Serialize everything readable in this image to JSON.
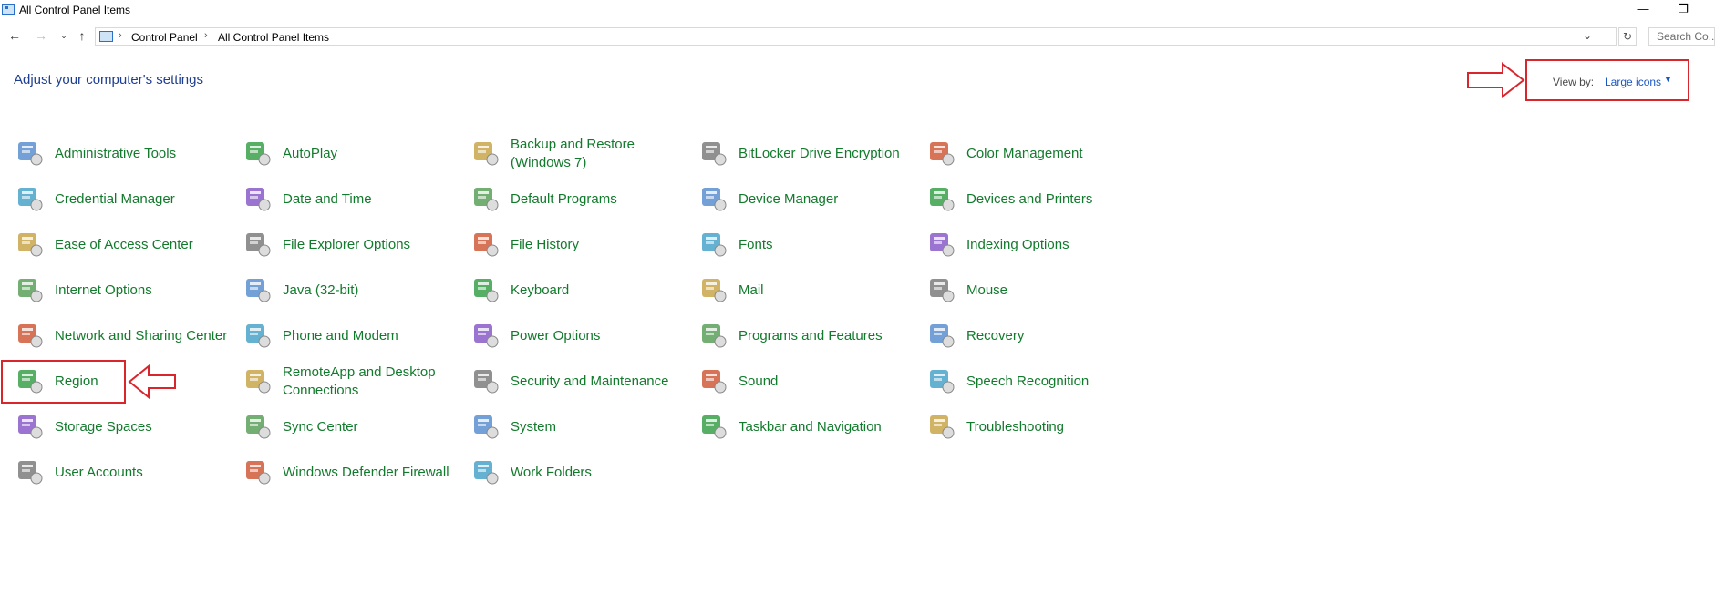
{
  "window": {
    "title": "All Control Panel Items",
    "minimize": "—",
    "restore": "❐"
  },
  "address": {
    "crumbs": [
      "Control Panel",
      "All Control Panel Items"
    ],
    "separator": "›",
    "search_placeholder": "Search Co..."
  },
  "header": {
    "title": "Adjust your computer's settings",
    "viewby_label": "View by:",
    "viewby_value": "Large icons"
  },
  "items": [
    {
      "label": "Administrative Tools",
      "icon": "administrative-tools-icon"
    },
    {
      "label": "AutoPlay",
      "icon": "autoplay-icon"
    },
    {
      "label": "Backup and Restore (Windows 7)",
      "icon": "backup-restore-icon"
    },
    {
      "label": "BitLocker Drive Encryption",
      "icon": "bitlocker-icon"
    },
    {
      "label": "Color Management",
      "icon": "color-management-icon"
    },
    {
      "label": "Credential Manager",
      "icon": "credential-manager-icon"
    },
    {
      "label": "Date and Time",
      "icon": "date-time-icon"
    },
    {
      "label": "Default Programs",
      "icon": "default-programs-icon"
    },
    {
      "label": "Device Manager",
      "icon": "device-manager-icon"
    },
    {
      "label": "Devices and Printers",
      "icon": "devices-printers-icon"
    },
    {
      "label": "Ease of Access Center",
      "icon": "ease-of-access-icon"
    },
    {
      "label": "File Explorer Options",
      "icon": "file-explorer-options-icon"
    },
    {
      "label": "File History",
      "icon": "file-history-icon"
    },
    {
      "label": "Fonts",
      "icon": "fonts-icon"
    },
    {
      "label": "Indexing Options",
      "icon": "indexing-options-icon"
    },
    {
      "label": "Internet Options",
      "icon": "internet-options-icon"
    },
    {
      "label": "Java (32-bit)",
      "icon": "java-icon"
    },
    {
      "label": "Keyboard",
      "icon": "keyboard-icon"
    },
    {
      "label": "Mail",
      "icon": "mail-icon"
    },
    {
      "label": "Mouse",
      "icon": "mouse-icon"
    },
    {
      "label": "Network and Sharing Center",
      "icon": "network-sharing-icon"
    },
    {
      "label": "Phone and Modem",
      "icon": "phone-modem-icon"
    },
    {
      "label": "Power Options",
      "icon": "power-options-icon"
    },
    {
      "label": "Programs and Features",
      "icon": "programs-features-icon"
    },
    {
      "label": "Recovery",
      "icon": "recovery-icon"
    },
    {
      "label": "Region",
      "icon": "region-icon"
    },
    {
      "label": "RemoteApp and Desktop Connections",
      "icon": "remoteapp-icon"
    },
    {
      "label": "Security and Maintenance",
      "icon": "security-maintenance-icon"
    },
    {
      "label": "Sound",
      "icon": "sound-icon"
    },
    {
      "label": "Speech Recognition",
      "icon": "speech-recognition-icon"
    },
    {
      "label": "Storage Spaces",
      "icon": "storage-spaces-icon"
    },
    {
      "label": "Sync Center",
      "icon": "sync-center-icon"
    },
    {
      "label": "System",
      "icon": "system-icon"
    },
    {
      "label": "Taskbar and Navigation",
      "icon": "taskbar-navigation-icon"
    },
    {
      "label": "Troubleshooting",
      "icon": "troubleshooting-icon"
    },
    {
      "label": "User Accounts",
      "icon": "user-accounts-icon"
    },
    {
      "label": "Windows Defender Firewall",
      "icon": "firewall-icon"
    },
    {
      "label": "Work Folders",
      "icon": "work-folders-icon"
    }
  ],
  "colors": {
    "item_text": "#127a2c",
    "heading": "#1e3e91",
    "link": "#1a56c4",
    "annotation": "#d9262c"
  }
}
